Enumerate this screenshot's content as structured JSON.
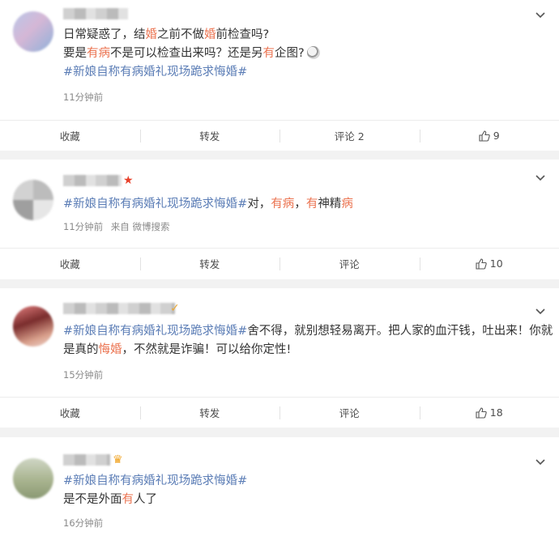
{
  "comments": [
    {
      "lines": [
        [
          {
            "t": "日常疑惑了，结"
          },
          {
            "t": "婚",
            "c": "hl"
          },
          {
            "t": "之前不做"
          },
          {
            "t": "婚",
            "c": "hl"
          },
          {
            "t": "前检查吗?"
          }
        ],
        [
          {
            "t": "要是"
          },
          {
            "t": "有病",
            "c": "hl"
          },
          {
            "t": "不是可以检查出来吗？还是另"
          },
          {
            "t": "有",
            "c": "hl"
          },
          {
            "t": "企图?"
          },
          {
            "e": "emoji"
          }
        ],
        [
          {
            "t": "#新娘自称有病婚礼现场跪求悔婚#",
            "c": "hashtag"
          }
        ]
      ],
      "time": "11分钟前",
      "source": "",
      "badge": "",
      "actions": {
        "favorite": "收藏",
        "repost": "转发",
        "comment": "评论 2",
        "like_count": "9"
      }
    },
    {
      "lines": [
        [
          {
            "t": "#新娘自称有病婚礼现场跪求悔婚#",
            "c": "hashtag"
          },
          {
            "t": "对，"
          },
          {
            "t": "有病",
            "c": "hl"
          },
          {
            "t": "，"
          },
          {
            "t": "有",
            "c": "hl"
          },
          {
            "t": "神精"
          },
          {
            "t": "病",
            "c": "hl"
          }
        ]
      ],
      "time": "11分钟前",
      "source": "来自 微博搜索",
      "badge": "★",
      "actions": {
        "favorite": "收藏",
        "repost": "转发",
        "comment": "评论",
        "like_count": "10"
      }
    },
    {
      "lines": [
        [
          {
            "t": "#新娘自称有病婚礼现场跪求悔婚#",
            "c": "hashtag"
          },
          {
            "t": "舍不得，就别想轻易离开。把人家的血汗钱，吐出来！你就"
          }
        ],
        [
          {
            "t": "是真的"
          },
          {
            "t": "悔婚",
            "c": "hl"
          },
          {
            "t": "，不然就是诈骗！可以给你定性!"
          }
        ]
      ],
      "time": "15分钟前",
      "source": "",
      "badge": "✓",
      "actions": {
        "favorite": "收藏",
        "repost": "转发",
        "comment": "评论",
        "like_count": "18"
      }
    },
    {
      "lines": [
        [
          {
            "t": "#新娘自称有病婚礼现场跪求悔婚#",
            "c": "hashtag"
          }
        ],
        [
          {
            "t": "是不是外面"
          },
          {
            "t": "有",
            "c": "hl"
          },
          {
            "t": "人了"
          }
        ]
      ],
      "time": "16分钟前",
      "source": "",
      "badge": "♛",
      "actions": null
    }
  ],
  "colors": {
    "hashtag": "#5b7db6",
    "highlight": "#eb7350",
    "background": "#f2f2f2"
  },
  "icons": {
    "menu": "chevron-down-icon",
    "like": "thumbs-up-icon"
  }
}
